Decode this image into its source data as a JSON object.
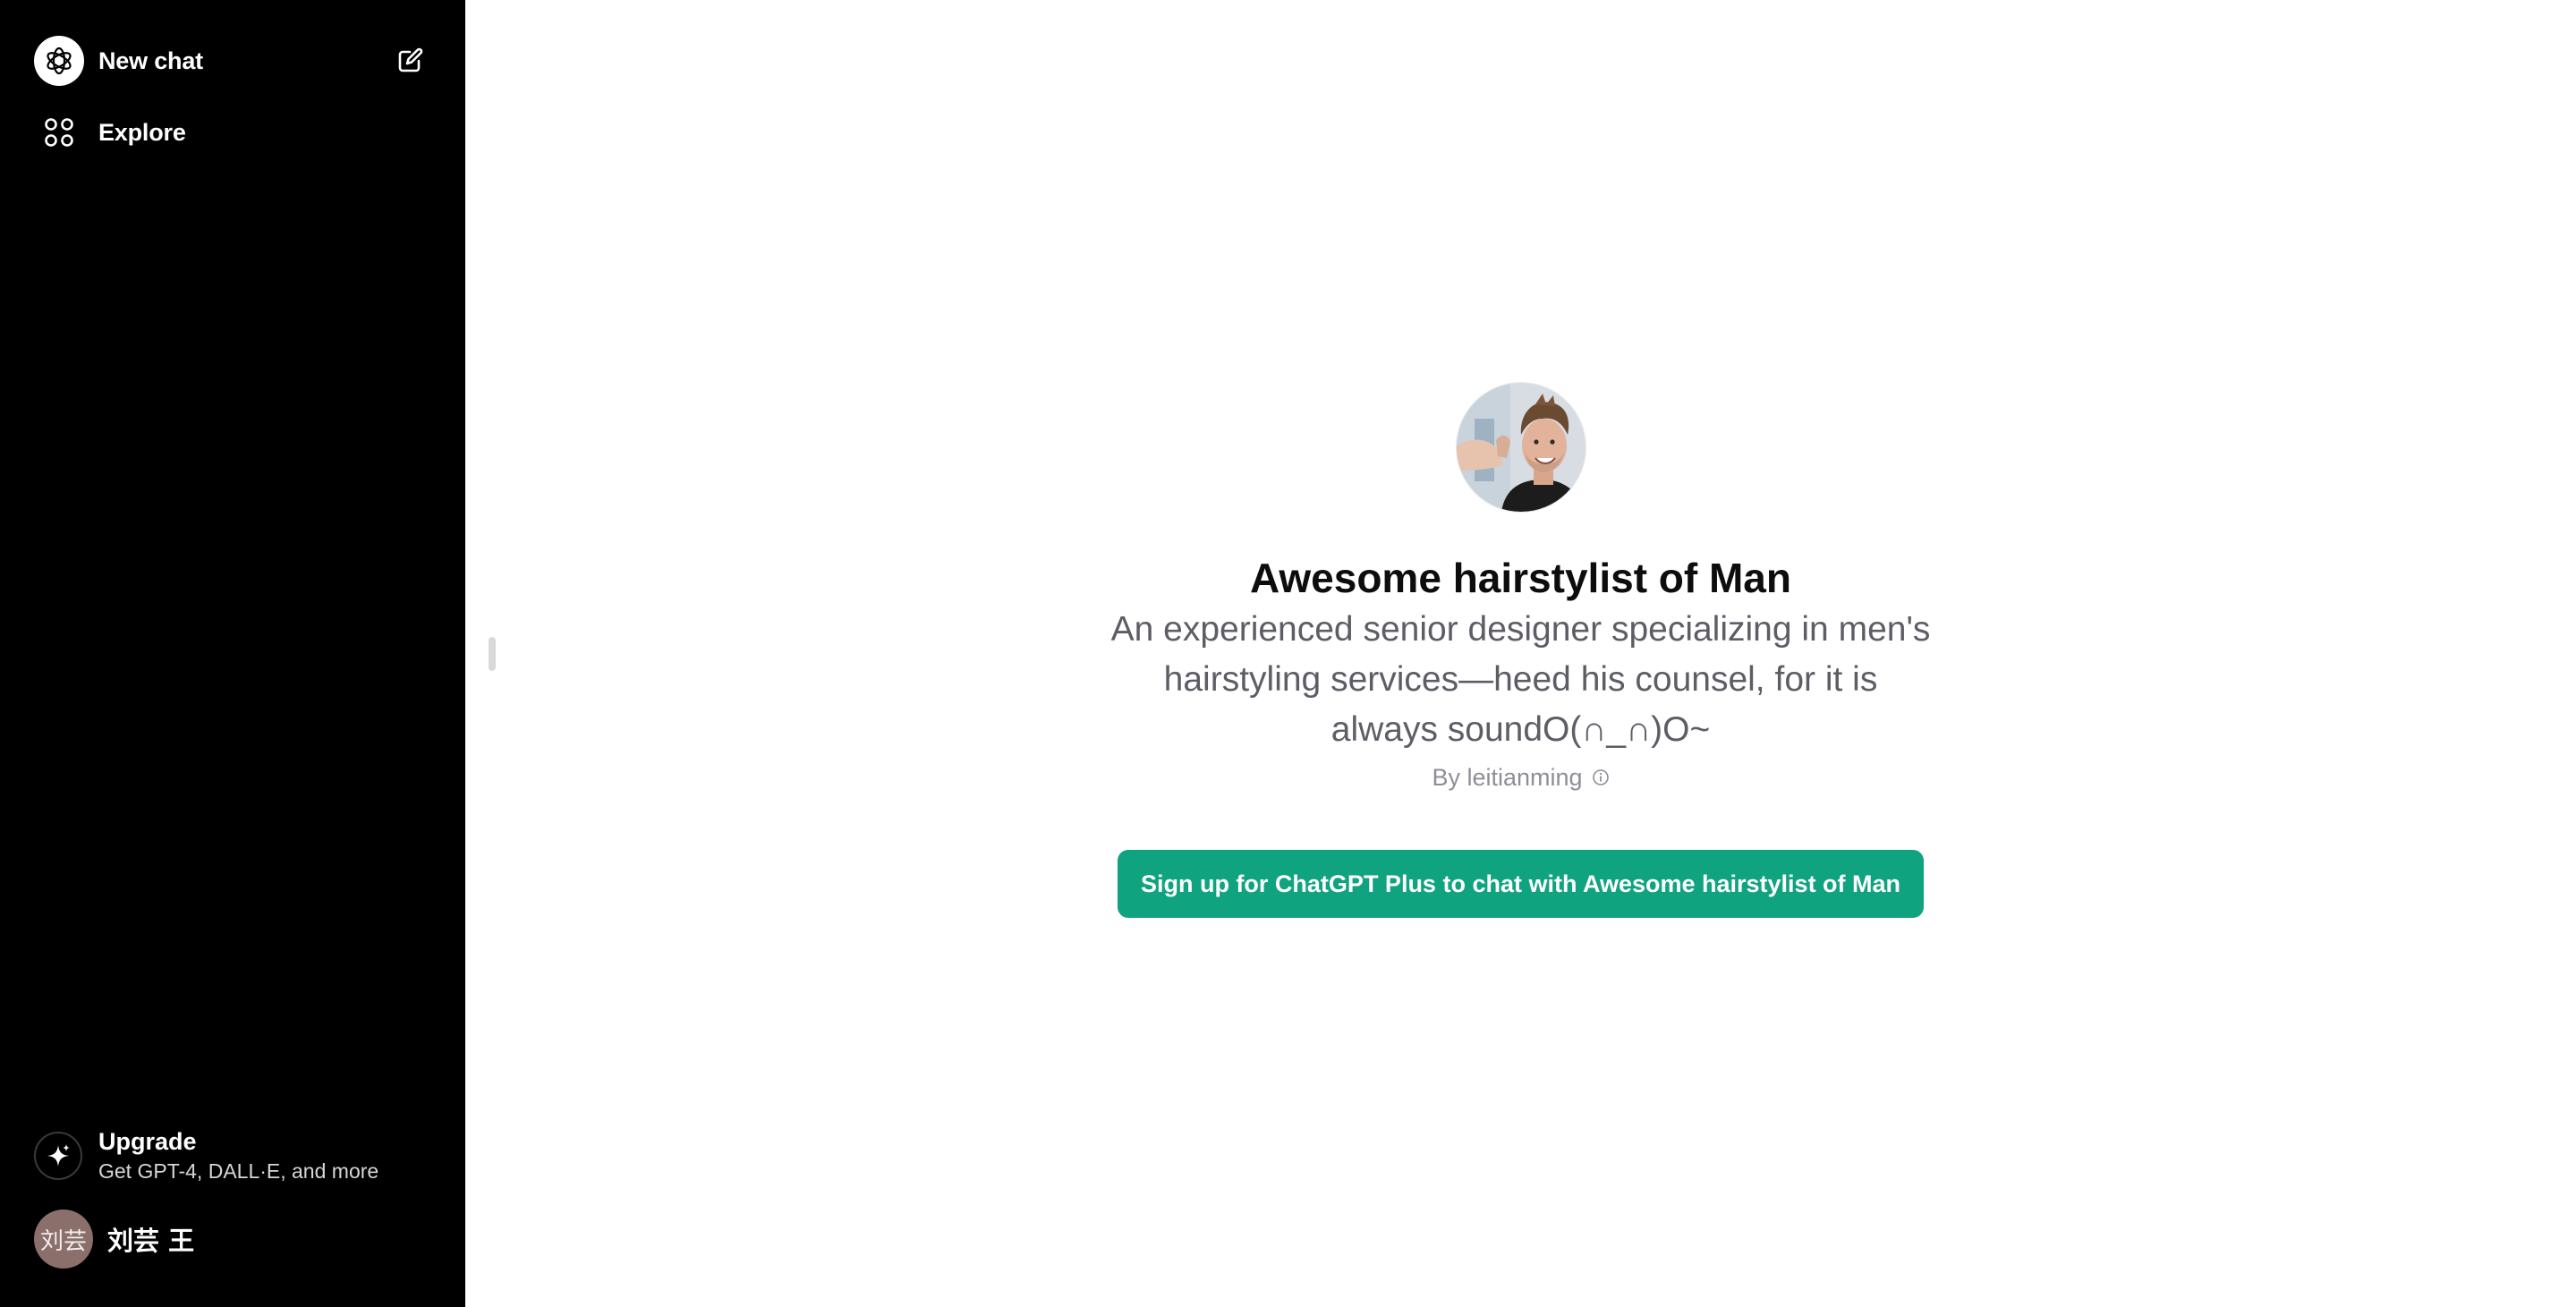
{
  "sidebar": {
    "new_chat_label": "New chat",
    "explore_label": "Explore",
    "upgrade": {
      "title": "Upgrade",
      "subtitle": "Get GPT-4, DALL·E, and more"
    },
    "user": {
      "avatar_text": "刘芸",
      "name": "刘芸 王"
    },
    "icons": [
      "openai-logo-icon",
      "edit-icon",
      "explore-grid-icon",
      "sparkle-icon"
    ]
  },
  "gpt": {
    "name": "Awesome hairstylist of Man",
    "description": "An experienced senior designer specializing in men's hairstyling services—heed his counsel, for it is always soundO(∩_∩)O~",
    "author": "By leitianming",
    "signup_button": "Sign up for ChatGPT Plus to chat with Awesome hairstylist of Man"
  },
  "colors": {
    "sidebar_bg": "#000000",
    "accent": "#10a37f",
    "description_text": "#5d5d66",
    "author_text": "#8e8e98"
  }
}
